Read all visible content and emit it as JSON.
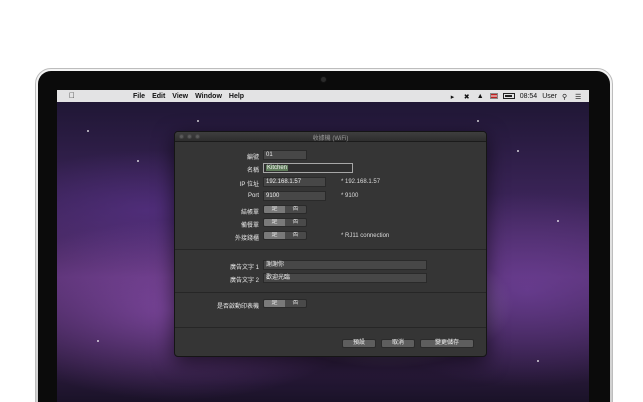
{
  "menubar": {
    "apple_icon": "apple-logo-icon",
    "menus": [
      "File",
      "Edit",
      "View",
      "Window",
      "Help"
    ],
    "status": {
      "time": "08:54",
      "user": "User"
    }
  },
  "window": {
    "title": "收據機 (WiFi)",
    "fields": {
      "number": {
        "label": "編號",
        "value": "01"
      },
      "name": {
        "label": "名稱",
        "value": "Kitchen"
      },
      "ip": {
        "label": "IP 位址",
        "value": "192.168.1.57",
        "note": "* 192.168.1.57"
      },
      "port": {
        "label": "Port",
        "value": "9100",
        "note": "* 9100"
      }
    },
    "toggles": {
      "checkout_slip": {
        "label": "結帳單"
      },
      "prep_slip": {
        "label": "備餐單"
      },
      "cash_drawer": {
        "label": "外接錢櫃",
        "note": "* RJ11 connection"
      },
      "auto_print": {
        "label": "是否啟動印表機"
      }
    },
    "toggle_yes": "是",
    "toggle_no": "否",
    "ads": {
      "ad1": {
        "label": "廣告文字 1",
        "value": "謝謝你"
      },
      "ad2": {
        "label": "廣告文字 2",
        "value": "歡迎光臨"
      }
    },
    "buttons": {
      "default": "預設",
      "cancel": "取消",
      "save": "變更儲存"
    }
  }
}
